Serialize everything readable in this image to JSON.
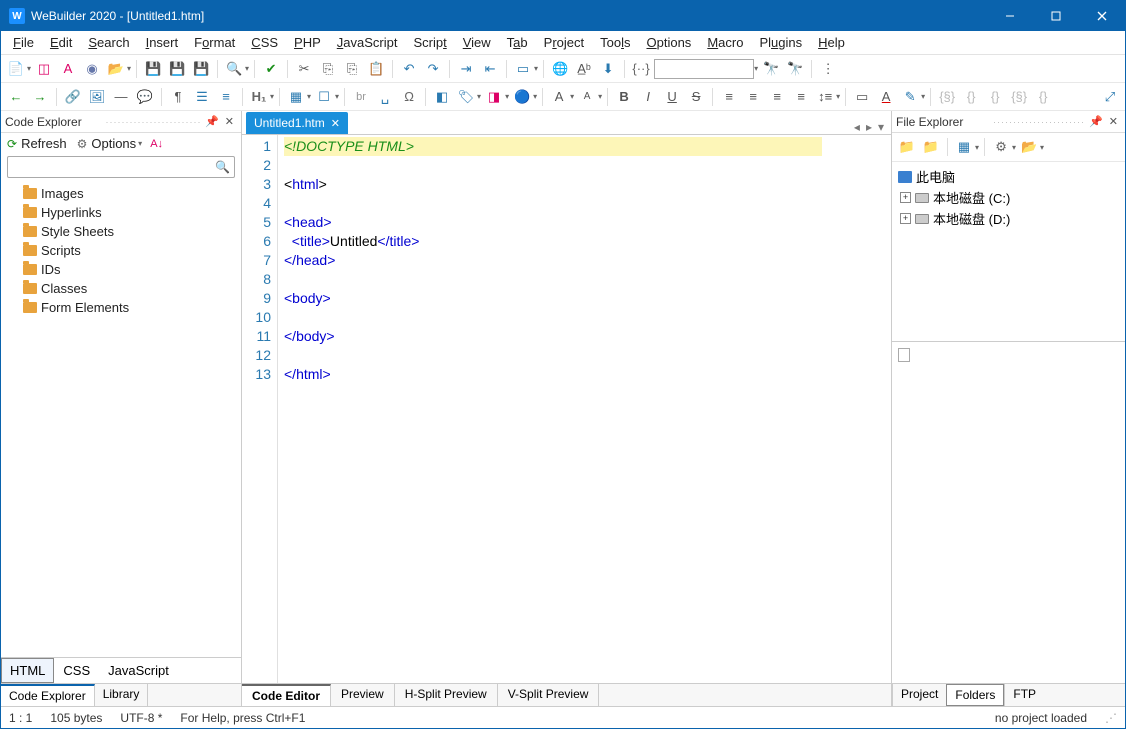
{
  "titlebar": {
    "text": "WeBuilder 2020 - [Untitled1.htm]"
  },
  "menu": [
    "File",
    "Edit",
    "Search",
    "Insert",
    "Format",
    "CSS",
    "PHP",
    "JavaScript",
    "Script",
    "View",
    "Tab",
    "Project",
    "Tools",
    "Options",
    "Macro",
    "Plugins",
    "Help"
  ],
  "codeExplorer": {
    "title": "Code Explorer",
    "refresh": "Refresh",
    "options": "Options",
    "items": [
      "Images",
      "Hyperlinks",
      "Style Sheets",
      "Scripts",
      "IDs",
      "Classes",
      "Form Elements"
    ],
    "langTabs": [
      "HTML",
      "CSS",
      "JavaScript"
    ],
    "bottomTabs": [
      "Code Explorer",
      "Library"
    ]
  },
  "fileTab": {
    "name": "Untitled1.htm"
  },
  "code": {
    "lines": 13,
    "l1": "<!DOCTYPE HTML>",
    "l3o": "<html>",
    "l5o": "<head>",
    "l6a": "<title>",
    "l6b": "Untitled",
    "l6c": "</title>",
    "l7": "</head>",
    "l9": "<body>",
    "l11": "</body>",
    "l13": "</html>"
  },
  "editorTabs": [
    "Code Editor",
    "Preview",
    "H-Split Preview",
    "V-Split Preview"
  ],
  "fileExplorer": {
    "title": "File Explorer",
    "root": "此电脑",
    "drives": [
      "本地磁盘 (C:)",
      "本地磁盘 (D:)"
    ],
    "rightTabs": [
      "Project",
      "Folders",
      "FTP"
    ]
  },
  "status": {
    "pos": "1 : 1",
    "size": "105 bytes",
    "enc": "UTF-8 *",
    "help": "For Help, press Ctrl+F1",
    "proj": "no project loaded"
  }
}
